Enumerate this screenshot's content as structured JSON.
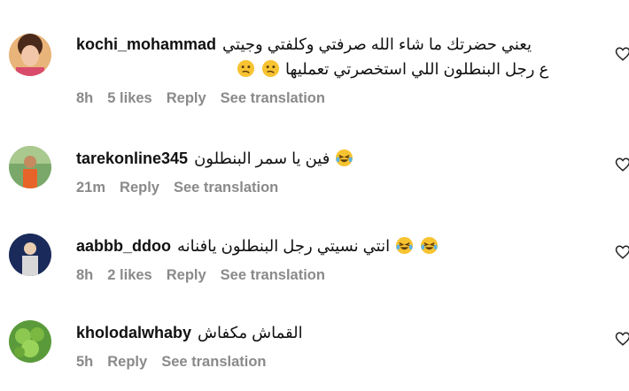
{
  "comments": [
    {
      "username": "kochi_mohammad",
      "text": "يعني حضرتك ما شاء الله صرفتي وكلفتي وجيتي",
      "text2": "ع رجل البنطلون اللي استخصرتي تعمليها",
      "emoji": [
        "confused-face",
        "confused-face"
      ],
      "time": "8h",
      "likes": "5 likes",
      "reply": "Reply",
      "translate": "See translation"
    },
    {
      "username": "tarekonline345",
      "text": "فين يا سمر البنطلون",
      "emoji": [
        "laughing-tears-face"
      ],
      "time": "21m",
      "likes": "",
      "reply": "Reply",
      "translate": "See translation"
    },
    {
      "username": "aabbb_ddoo",
      "text": "انتي نسيتي رجل البنطلون يافنانه",
      "emoji": [
        "laughing-tears-face",
        "laughing-tears-face"
      ],
      "time": "8h",
      "likes": "2 likes",
      "reply": "Reply",
      "translate": "See translation"
    },
    {
      "username": "kholodalwhaby",
      "text": "القماش مكفاش",
      "emoji": [],
      "time": "5h",
      "likes": "",
      "reply": "Reply",
      "translate": "See translation"
    }
  ],
  "colors": {
    "meta_gray": "#8a8a8a",
    "emoji_yellow": "#f7c331"
  }
}
